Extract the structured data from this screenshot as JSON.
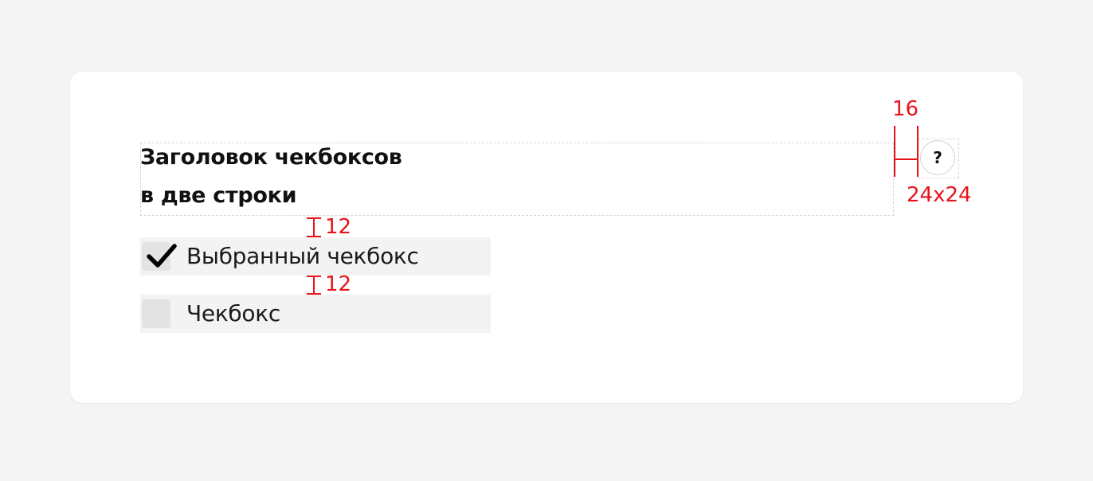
{
  "checkbox_group": {
    "title_line1": "Заголовок чекбоксов",
    "title_line2": "в две строки",
    "help_symbol": "?",
    "items": [
      {
        "label": "Выбранный чекбокс",
        "checked": true
      },
      {
        "label": "Чекбокс",
        "checked": false
      }
    ]
  },
  "annotations": {
    "help_gap": "16",
    "help_size": "24x24",
    "gap_title_to_first": "12",
    "gap_between_items": "12",
    "color": "#e8131b"
  }
}
